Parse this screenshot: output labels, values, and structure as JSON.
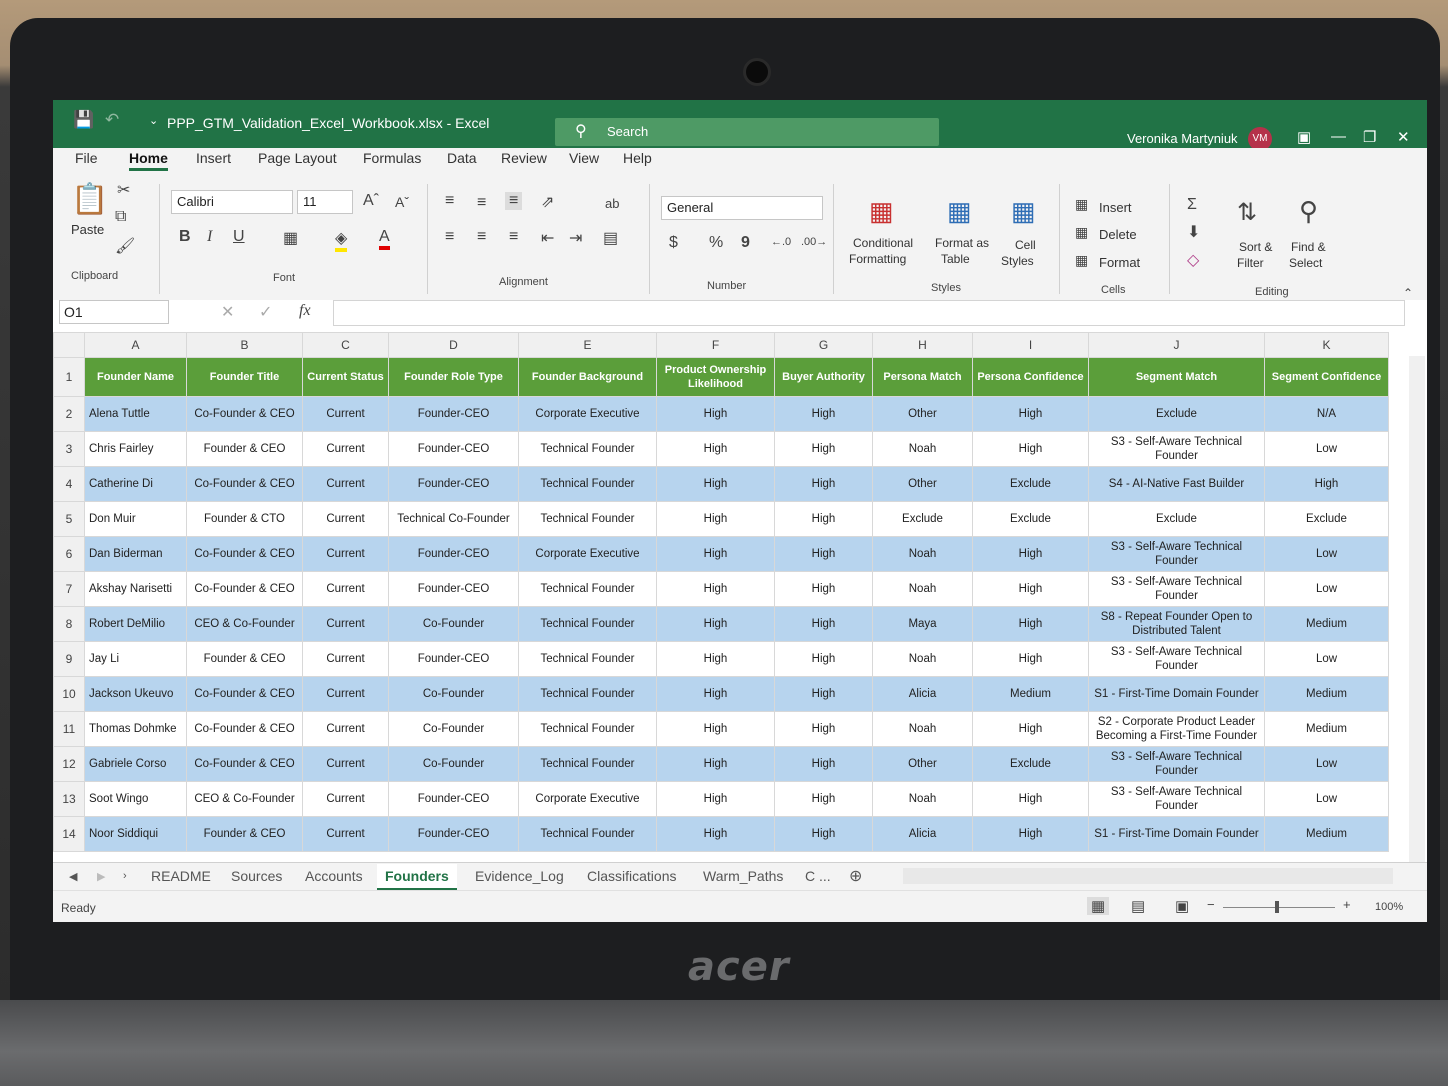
{
  "app": {
    "file_title": "PPP_GTM_Validation_Excel_Workbook.xlsx  -  Excel",
    "search_label": "Search",
    "user_name": "Veronika Martyniuk",
    "user_initials": "VM",
    "brand": "acer"
  },
  "menu": [
    "File",
    "Home",
    "Insert",
    "Page Layout",
    "Formulas",
    "Data",
    "Review",
    "View",
    "Help"
  ],
  "ribbon": {
    "paste": "Paste",
    "clipboard": "Clipboard",
    "font_name": "Calibri",
    "font_size": "11",
    "font": "Font",
    "alignment": "Alignment",
    "number_format": "General",
    "number": "Number",
    "conditional_formatting_1": "Conditional",
    "conditional_formatting_2": "Formatting",
    "format_as_table_1": "Format as",
    "format_as_table_2": "Table",
    "cell_styles_1": "Cell",
    "cell_styles_2": "Styles",
    "styles": "Styles",
    "insert": "Insert",
    "delete": "Delete",
    "format": "Format",
    "cells": "Cells",
    "sort_filter_1": "Sort &",
    "sort_filter_2": "Filter",
    "find_select_1": "Find &",
    "find_select_2": "Select",
    "editing": "Editing",
    "bold": "B",
    "italic": "I",
    "underline": "U",
    "font_color": "A",
    "currency": "$",
    "percent": "%",
    "comma": "9"
  },
  "formula_bar": {
    "name_box": "O1",
    "fx": "fx",
    "value": ""
  },
  "sheet": {
    "columns": [
      "A",
      "B",
      "C",
      "D",
      "E",
      "F",
      "G",
      "H",
      "I",
      "J",
      "K"
    ],
    "headers": [
      "Founder Name",
      "Founder Title",
      "Current Status",
      "Founder Role Type",
      "Founder Background",
      "Product Ownership Likelihood",
      "Buyer Authority",
      "Persona Match",
      "Persona Confidence",
      "Segment Match",
      "Segment Confidence"
    ],
    "rows": [
      {
        "n": "2",
        "cells": [
          "Alena Tuttle",
          "Co-Founder & CEO",
          "Current",
          "Founder-CEO",
          "Corporate Executive",
          "High",
          "High",
          "Other",
          "High",
          "Exclude",
          "N/A"
        ]
      },
      {
        "n": "3",
        "cells": [
          "Chris Fairley",
          "Founder & CEO",
          "Current",
          "Founder-CEO",
          "Technical Founder",
          "High",
          "High",
          "Noah",
          "High",
          "S3 - Self-Aware Technical Founder",
          "Low"
        ]
      },
      {
        "n": "4",
        "cells": [
          "Catherine Di",
          "Co-Founder & CEO",
          "Current",
          "Founder-CEO",
          "Technical Founder",
          "High",
          "High",
          "Other",
          "Exclude",
          "S4 - AI-Native Fast Builder",
          "High"
        ]
      },
      {
        "n": "5",
        "cells": [
          "Don Muir",
          "Founder & CTO",
          "Current",
          "Technical Co-Founder",
          "Technical Founder",
          "High",
          "High",
          "Exclude",
          "Exclude",
          "Exclude",
          "Exclude"
        ]
      },
      {
        "n": "6",
        "cells": [
          "Dan Biderman",
          "Co-Founder & CEO",
          "Current",
          "Founder-CEO",
          "Corporate Executive",
          "High",
          "High",
          "Noah",
          "High",
          "S3 - Self-Aware Technical Founder",
          "Low"
        ]
      },
      {
        "n": "7",
        "cells": [
          "Akshay Narisetti",
          "Co-Founder & CEO",
          "Current",
          "Founder-CEO",
          "Technical Founder",
          "High",
          "High",
          "Noah",
          "High",
          "S3 - Self-Aware Technical Founder",
          "Low"
        ]
      },
      {
        "n": "8",
        "cells": [
          "Robert DeMilio",
          "CEO & Co-Founder",
          "Current",
          "Co-Founder",
          "Technical Founder",
          "High",
          "High",
          "Maya",
          "High",
          "S8 - Repeat Founder Open to Distributed Talent",
          "Medium"
        ]
      },
      {
        "n": "9",
        "cells": [
          "Jay Li",
          "Founder & CEO",
          "Current",
          "Founder-CEO",
          "Technical Founder",
          "High",
          "High",
          "Noah",
          "High",
          "S3 - Self-Aware Technical Founder",
          "Low"
        ]
      },
      {
        "n": "10",
        "cells": [
          "Jackson Ukeuvo",
          "Co-Founder & CEO",
          "Current",
          "Co-Founder",
          "Technical Founder",
          "High",
          "High",
          "Alicia",
          "Medium",
          "S1 - First-Time Domain Founder",
          "Medium"
        ]
      },
      {
        "n": "11",
        "cells": [
          "Thomas Dohmke",
          "Co-Founder & CEO",
          "Current",
          "Co-Founder",
          "Technical Founder",
          "High",
          "High",
          "Noah",
          "High",
          "S2 - Corporate Product Leader Becoming a First-Time Founder",
          "Medium"
        ]
      },
      {
        "n": "12",
        "cells": [
          "Gabriele Corso",
          "Co-Founder & CEO",
          "Current",
          "Co-Founder",
          "Technical Founder",
          "High",
          "High",
          "Other",
          "Exclude",
          "S3 - Self-Aware Technical Founder",
          "Low"
        ]
      },
      {
        "n": "13",
        "cells": [
          "Soot Wingo",
          "CEO & Co-Founder",
          "Current",
          "Founder-CEO",
          "Corporate Executive",
          "High",
          "High",
          "Noah",
          "High",
          "S3 - Self-Aware Technical Founder",
          "Low"
        ]
      },
      {
        "n": "14",
        "cells": [
          "Noor Siddiqui",
          "Founder & CEO",
          "Current",
          "Founder-CEO",
          "Technical Founder",
          "High",
          "High",
          "Alicia",
          "High",
          "S1 - First-Time Domain Founder",
          "Medium"
        ]
      }
    ]
  },
  "sheet_tabs": [
    "README",
    "Sources",
    "Accounts",
    "Founders",
    "Evidence_Log",
    "Classifications",
    "Warm_Paths",
    "C ..."
  ],
  "active_sheet": "Founders",
  "status": {
    "ready": "Ready",
    "zoom": "100%"
  },
  "colors": {
    "excel_green": "#217346",
    "header_green": "#5b9e3a",
    "band_blue": "#b7d4ee"
  }
}
